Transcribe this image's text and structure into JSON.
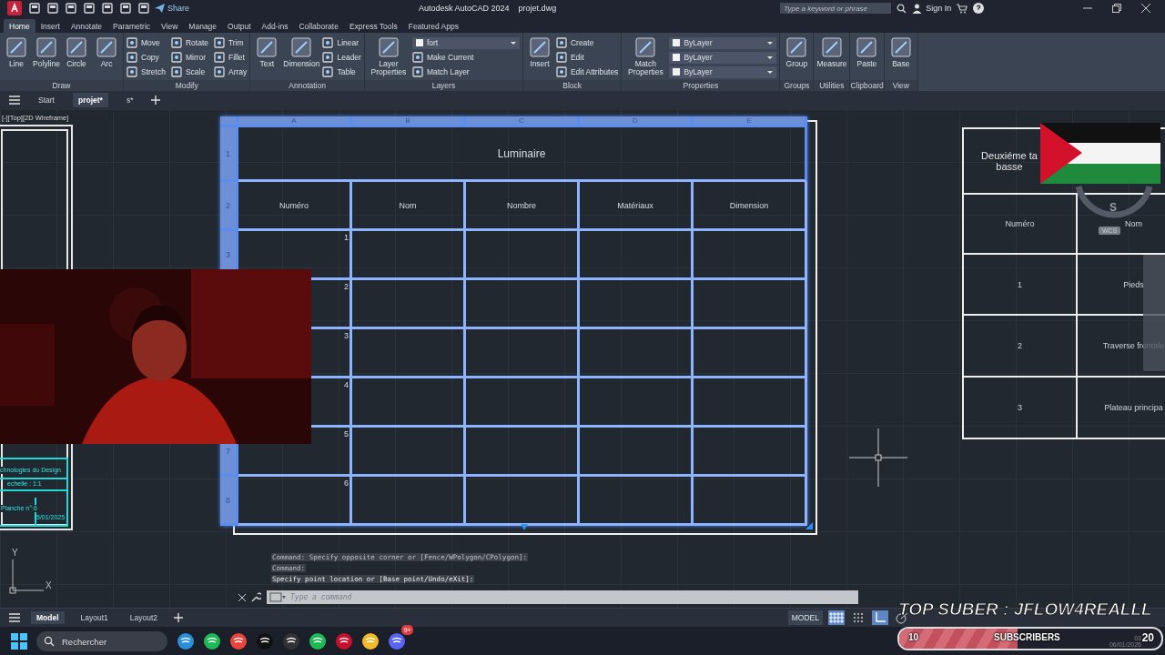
{
  "title_bar": {
    "share": "Share",
    "title": "Autodesk AutoCAD 2024",
    "file": "projet.dwg",
    "search_placeholder": "Type a keyword or phrase",
    "sign_in": "Sign In"
  },
  "ribbon_tabs": [
    {
      "label": "Home",
      "selected": true
    },
    {
      "label": "Insert",
      "selected": false
    },
    {
      "label": "Annotate",
      "selected": false
    },
    {
      "label": "Parametric",
      "selected": false
    },
    {
      "label": "View",
      "selected": false
    },
    {
      "label": "Manage",
      "selected": false
    },
    {
      "label": "Output",
      "selected": false
    },
    {
      "label": "Add-ins",
      "selected": false
    },
    {
      "label": "Collaborate",
      "selected": false
    },
    {
      "label": "Express Tools",
      "selected": false
    },
    {
      "label": "Featured Apps",
      "selected": false
    }
  ],
  "ribbon_panels": [
    {
      "title": "Draw",
      "tools": [
        {
          "kind": "big",
          "label": "Line"
        },
        {
          "kind": "big",
          "label": "Polyline"
        },
        {
          "kind": "big",
          "label": "Circle"
        },
        {
          "kind": "big",
          "label": "Arc"
        }
      ]
    },
    {
      "title": "Modify",
      "tools": [
        {
          "kind": "small",
          "label": "Move"
        },
        {
          "kind": "small",
          "label": "Copy"
        },
        {
          "kind": "small",
          "label": "Stretch"
        },
        {
          "kind": "small",
          "label": "Rotate"
        },
        {
          "kind": "small",
          "label": "Mirror"
        },
        {
          "kind": "small",
          "label": "Scale"
        },
        {
          "kind": "small",
          "label": "Trim"
        },
        {
          "kind": "small",
          "label": "Fillet"
        },
        {
          "kind": "small",
          "label": "Array"
        }
      ]
    },
    {
      "title": "Annotation",
      "tools": [
        {
          "kind": "big",
          "label": "Text"
        },
        {
          "kind": "big",
          "label": "Dimension"
        },
        {
          "kind": "small",
          "label": "Linear"
        },
        {
          "kind": "small",
          "label": "Leader"
        },
        {
          "kind": "small",
          "label": "Table"
        }
      ]
    },
    {
      "title": "Layers",
      "tools": [
        {
          "kind": "big",
          "label": "Layer Properties"
        },
        {
          "kind": "dropdown",
          "label": "fort"
        },
        {
          "kind": "small",
          "label": "Make Current"
        },
        {
          "kind": "small",
          "label": "Match Layer"
        }
      ]
    },
    {
      "title": "Block",
      "tools": [
        {
          "kind": "big",
          "label": "Insert"
        },
        {
          "kind": "small",
          "label": "Create"
        },
        {
          "kind": "small",
          "label": "Edit"
        },
        {
          "kind": "small",
          "label": "Edit Attributes"
        }
      ]
    },
    {
      "title": "Properties",
      "tools": [
        {
          "kind": "big",
          "label": "Match Properties"
        },
        {
          "kind": "dropdown",
          "label": "ByLayer"
        },
        {
          "kind": "dropdown",
          "label": "ByLayer"
        },
        {
          "kind": "dropdown",
          "label": "ByLayer"
        }
      ]
    },
    {
      "title": "Groups",
      "tools": [
        {
          "kind": "big",
          "label": "Group"
        }
      ]
    },
    {
      "title": "Utilities",
      "tools": [
        {
          "kind": "big",
          "label": "Measure"
        }
      ]
    },
    {
      "title": "Clipboard",
      "tools": [
        {
          "kind": "big",
          "label": "Paste"
        }
      ]
    },
    {
      "title": "View",
      "tools": [
        {
          "kind": "big",
          "label": "Base"
        }
      ]
    }
  ],
  "file_tabs": [
    {
      "label": "Start",
      "selected": false
    },
    {
      "label": "projet*",
      "selected": true
    },
    {
      "label": "s*",
      "selected": false
    }
  ],
  "viewport_label": "[-][Top][2D Wireframe]",
  "main_table": {
    "columns": [
      "A",
      "B",
      "C",
      "D",
      "E"
    ],
    "title_row_label": "1",
    "title": "Luminaire",
    "header_row_label": "2",
    "headers": [
      "Numéro",
      "Nom",
      "Nombre",
      "Matériaux",
      "Dimension"
    ],
    "rows": [
      {
        "row_label": "3",
        "number": "1"
      },
      {
        "number": "2"
      },
      {
        "number": "3"
      },
      {
        "number": "4"
      },
      {
        "row_label": "7",
        "number": "5"
      },
      {
        "row_label": "8",
        "number": "6"
      }
    ]
  },
  "second_table": {
    "title_lines": [
      "Deuxiéme ta",
      "basse"
    ],
    "headers": [
      "Numéro",
      "Nom"
    ],
    "rows": [
      [
        "1",
        "Pieds"
      ],
      [
        "2",
        "Traverse frontale"
      ],
      [
        "3",
        "Plateau principa"
      ]
    ]
  },
  "view_cube": {
    "direction": "S",
    "ucs": "WCS"
  },
  "title_block": {
    "lines": [
      "chnologies du Design",
      "echelle :  1:1",
      "Planche n°:6",
      "5/01/2025"
    ]
  },
  "ucs_axes": {
    "x": "X",
    "y": "Y"
  },
  "command_history": [
    "Command: Specify opposite corner or [Fence/WPolygon/CPolygon]:",
    "Command:",
    "Specify point location or [Base point/Undo/eXit]:"
  ],
  "command_placeholder": "Type a command",
  "layout_tabs": [
    {
      "label": "Model",
      "selected": true
    },
    {
      "label": "Layout1",
      "selected": false
    },
    {
      "label": "Layout2",
      "selected": false
    }
  ],
  "status_bar": {
    "space": "MODEL"
  },
  "taskbar": {
    "search": "Rechercher",
    "badge": "9+",
    "time": "03",
    "date": "06/01/2026"
  },
  "stream_overlay": {
    "top_sub": "TOP SUBER : JFLOW4REALLL",
    "count": "10",
    "label": "SUBSCRIBERS",
    "goal": "20",
    "level": 0.45
  }
}
